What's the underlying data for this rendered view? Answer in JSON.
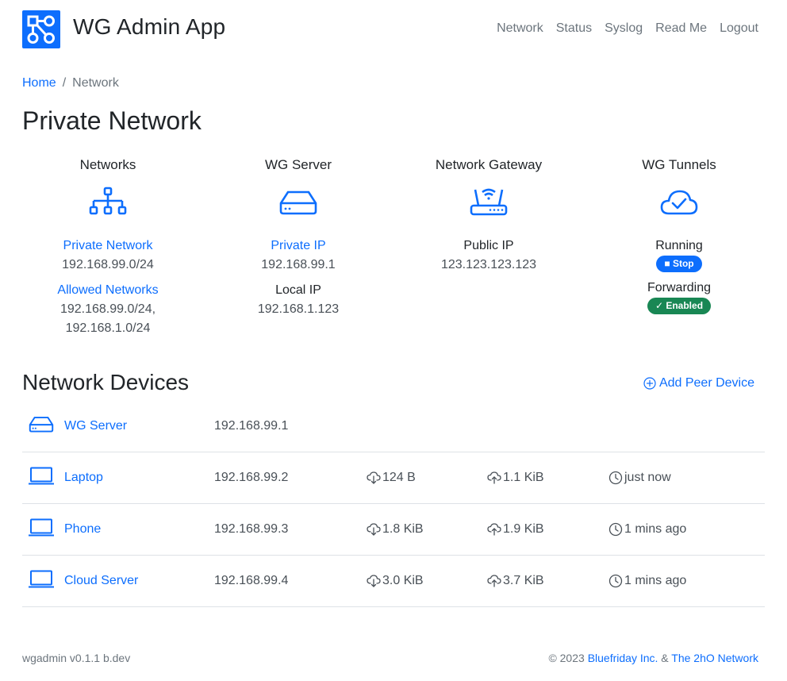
{
  "app": {
    "title": "WG Admin App",
    "logo_icon": "network-nodes-icon",
    "brand_color": "#0d6efd"
  },
  "nav": {
    "items": [
      {
        "label": "Network"
      },
      {
        "label": "Status"
      },
      {
        "label": "Syslog"
      },
      {
        "label": "Read Me"
      },
      {
        "label": "Logout"
      }
    ]
  },
  "breadcrumb": {
    "home": "Home",
    "separator": "/",
    "current": "Network"
  },
  "page": {
    "title": "Private Network"
  },
  "summary": {
    "networks": {
      "title": "Networks",
      "icon": "sitemap-icon",
      "private_label": "Private Network",
      "private_value": "192.168.99.0/24",
      "allowed_label": "Allowed Networks",
      "allowed_value_1": "192.168.99.0/24,",
      "allowed_value_2": "192.168.1.0/24"
    },
    "server": {
      "title": "WG Server",
      "icon": "server-icon",
      "private_ip_label": "Private IP",
      "private_ip_value": "192.168.99.1",
      "local_ip_label": "Local IP",
      "local_ip_value": "192.168.1.123"
    },
    "gateway": {
      "title": "Network Gateway",
      "icon": "router-icon",
      "public_ip_label": "Public IP",
      "public_ip_value": "123.123.123.123"
    },
    "tunnels": {
      "title": "WG Tunnels",
      "icon": "cloud-check-icon",
      "running_label": "Running",
      "stop_button": "Stop",
      "forwarding_label": "Forwarding",
      "enabled_badge": "Enabled",
      "stop_color": "#0d6efd",
      "enabled_color": "#198754"
    }
  },
  "devices": {
    "title": "Network Devices",
    "add_label": "Add Peer Device",
    "rows": [
      {
        "icon": "server-icon",
        "name": "WG Server",
        "ip": "192.168.99.1",
        "rx": "",
        "tx": "",
        "seen": ""
      },
      {
        "icon": "laptop-icon",
        "name": "Laptop",
        "ip": "192.168.99.2",
        "rx": "124 B",
        "tx": "1.1 KiB",
        "seen": "just now"
      },
      {
        "icon": "laptop-icon",
        "name": "Phone",
        "ip": "192.168.99.3",
        "rx": "1.8 KiB",
        "tx": "1.9 KiB",
        "seen": "1 mins ago"
      },
      {
        "icon": "laptop-icon",
        "name": "Cloud Server",
        "ip": "192.168.99.4",
        "rx": "3.0 KiB",
        "tx": "3.7 KiB",
        "seen": "1 mins ago"
      }
    ]
  },
  "footer": {
    "version": "wgadmin v0.1.1 b.dev",
    "copyright": "© 2023",
    "company": "Bluefriday Inc.",
    "amp": "&",
    "network": "The 2hO Network"
  }
}
